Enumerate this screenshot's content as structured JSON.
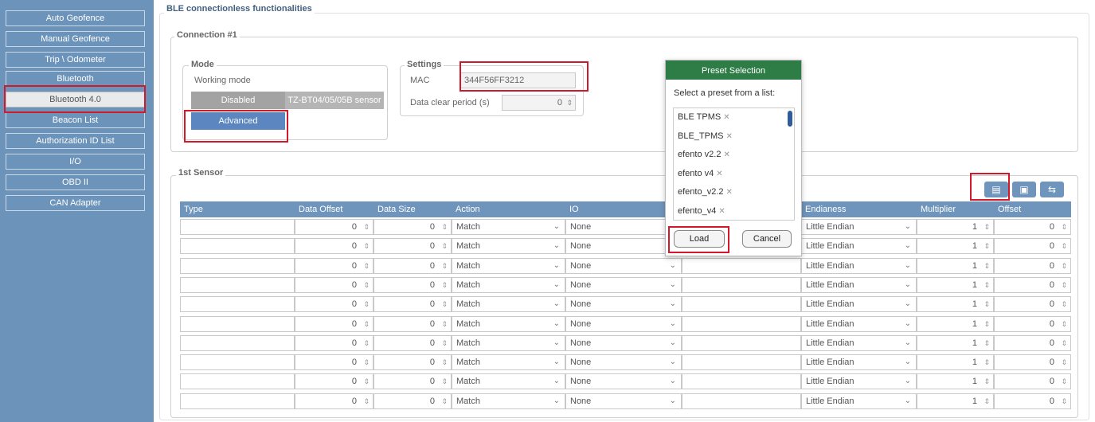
{
  "sidebar": {
    "items": [
      {
        "label": "Auto Geofence",
        "selected": false
      },
      {
        "label": "Manual Geofence",
        "selected": false
      },
      {
        "label": "Trip \\ Odometer",
        "selected": false
      },
      {
        "label": "Bluetooth",
        "selected": false
      },
      {
        "label": "Bluetooth 4.0",
        "selected": true
      },
      {
        "label": "Beacon List",
        "selected": false
      },
      {
        "label": "Authorization ID List",
        "selected": false
      },
      {
        "label": "I/O",
        "selected": false
      },
      {
        "label": "OBD II",
        "selected": false
      },
      {
        "label": "CAN Adapter",
        "selected": false
      }
    ]
  },
  "main": {
    "title": "BLE connectionless functionalities",
    "connection": {
      "title": "Connection #1",
      "mode": {
        "title": "Mode",
        "working_mode_label": "Working mode",
        "disabled_label": "Disabled",
        "sensor_label": "TZ-BT04/05/05B sensor",
        "advanced_label": "Advanced"
      },
      "settings": {
        "title": "Settings",
        "mac_label": "MAC",
        "mac_value": "344F56FF3212",
        "clear_label": "Data clear period  (s)",
        "clear_value": "0"
      }
    },
    "sensor": {
      "title": "1st Sensor",
      "columns": [
        "Type",
        "Data Offset",
        "Data Size",
        "Action",
        "IO",
        "",
        "Endianess",
        "Multiplier",
        "Offset"
      ],
      "rows": [
        {
          "type": "",
          "data_offset": "0",
          "data_size": "0",
          "action": "Match",
          "io": "None",
          "endianess": "Little Endian",
          "multiplier": "1",
          "offset": "0"
        },
        {
          "type": "",
          "data_offset": "0",
          "data_size": "0",
          "action": "Match",
          "io": "None",
          "endianess": "Little Endian",
          "multiplier": "1",
          "offset": "0"
        },
        {
          "type": "",
          "data_offset": "0",
          "data_size": "0",
          "action": "Match",
          "io": "None",
          "endianess": "Little Endian",
          "multiplier": "1",
          "offset": "0"
        },
        {
          "type": "",
          "data_offset": "0",
          "data_size": "0",
          "action": "Match",
          "io": "None",
          "endianess": "Little Endian",
          "multiplier": "1",
          "offset": "0"
        },
        {
          "type": "",
          "data_offset": "0",
          "data_size": "0",
          "action": "Match",
          "io": "None",
          "endianess": "Little Endian",
          "multiplier": "1",
          "offset": "0"
        },
        {
          "type": "",
          "data_offset": "0",
          "data_size": "0",
          "action": "Match",
          "io": "None",
          "endianess": "Little Endian",
          "multiplier": "1",
          "offset": "0"
        },
        {
          "type": "",
          "data_offset": "0",
          "data_size": "0",
          "action": "Match",
          "io": "None",
          "endianess": "Little Endian",
          "multiplier": "1",
          "offset": "0"
        },
        {
          "type": "",
          "data_offset": "0",
          "data_size": "0",
          "action": "Match",
          "io": "None",
          "endianess": "Little Endian",
          "multiplier": "1",
          "offset": "0"
        },
        {
          "type": "",
          "data_offset": "0",
          "data_size": "0",
          "action": "Match",
          "io": "None",
          "endianess": "Little Endian",
          "multiplier": "1",
          "offset": "0"
        },
        {
          "type": "",
          "data_offset": "0",
          "data_size": "0",
          "action": "Match",
          "io": "None",
          "endianess": "Little Endian",
          "multiplier": "1",
          "offset": "0"
        }
      ],
      "toolbar_icons": [
        "load-preset-icon",
        "save-icon",
        "reset-icon"
      ]
    }
  },
  "dialog": {
    "title": "Preset Selection",
    "prompt": "Select a preset from a list:",
    "items": [
      "BLE TPMS",
      "BLE_TPMS",
      "efento v2.2",
      "efento v4",
      "efento_v2.2",
      "efento_v4"
    ],
    "load_label": "Load",
    "cancel_label": "Cancel"
  },
  "colors": {
    "sidebar_bg": "#6c93ba",
    "table_header": "#6f95bc",
    "dialog_header": "#2e7d46",
    "advanced_button": "#5b86c0",
    "disabled_button": "#a3a3a3",
    "highlight": "#d0192b"
  }
}
